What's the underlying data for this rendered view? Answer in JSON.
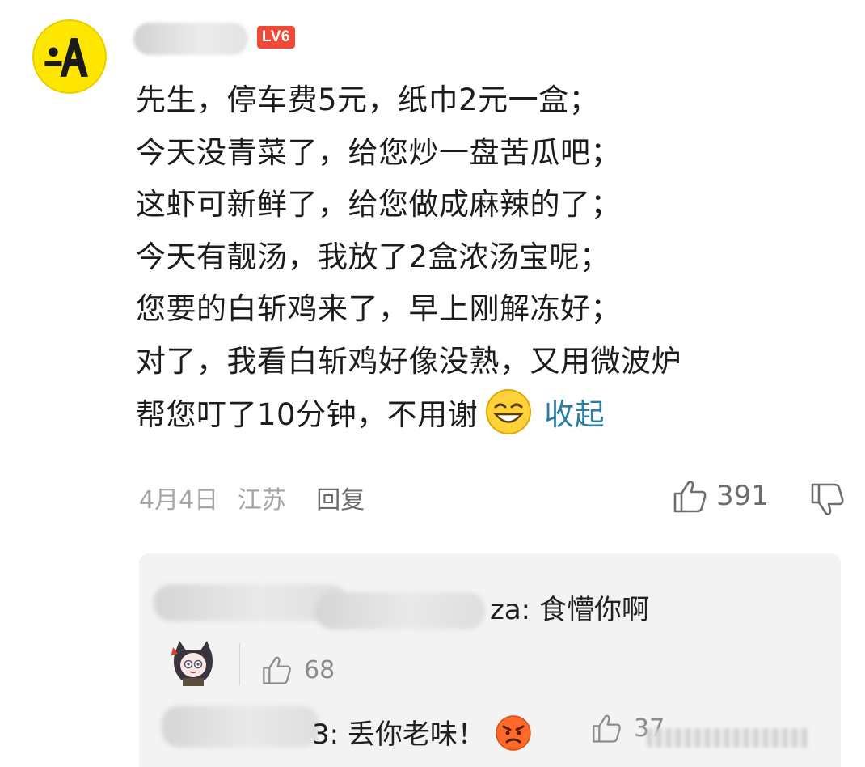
{
  "comment": {
    "level_badge": "LV6",
    "lines": [
      "先生，停车费5元，纸巾2元一盒；",
      "今天没青菜了，给您炒一盘苦瓜吧；",
      "这虾可新鲜了，给您做成麻辣的了；",
      "今天有靓汤，我放了2盒浓汤宝呢；",
      "您要的白斩鸡来了，早上刚解冻好；",
      "对了，我看白斩鸡好像没熟，又用微波炉",
      "帮您叮了10分钟，不用谢"
    ],
    "collapse_label": "收起",
    "date": "4月4日",
    "location": "江苏",
    "reply_label": "回复",
    "like_count": "391"
  },
  "replies": [
    {
      "text": "za: 食懵你啊",
      "like_count": "68"
    },
    {
      "text": "3: 丢你老味！",
      "like_count": "37"
    }
  ],
  "icons": {
    "avatar": "yellow-a-logo-icon",
    "like": "thumbs-up-icon",
    "dislike": "thumbs-down-icon",
    "grin_emoji": "grinning-face-icon",
    "angry_emoji": "angry-face-icon"
  },
  "colors": {
    "badge": "#f04a36",
    "link": "#2a7ea6",
    "avatar_bg": "#ffe600"
  }
}
